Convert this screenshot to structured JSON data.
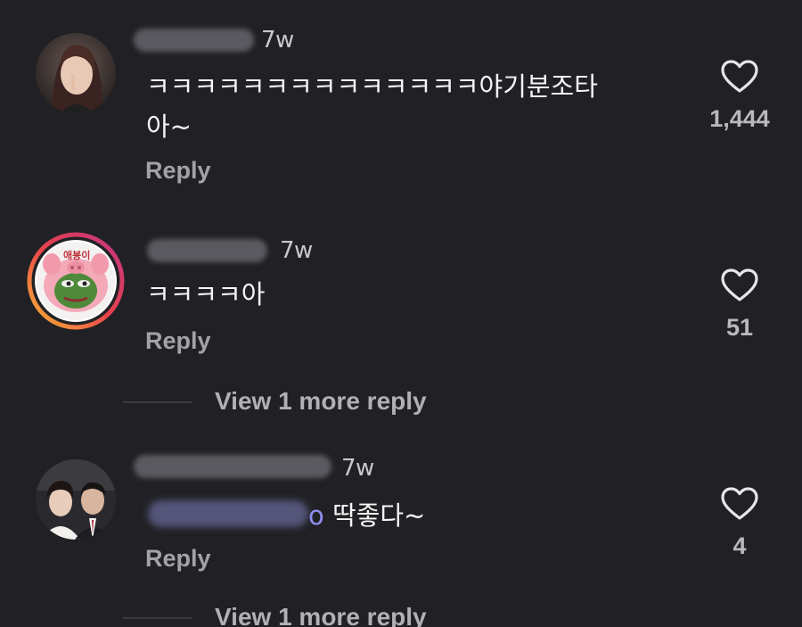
{
  "comments": [
    {
      "time": "7w",
      "text_line1": "ㅋㅋㅋㅋㅋㅋㅋㅋㅋㅋㅋㅋㅋㅋ야기분조타",
      "text_line2": "아~",
      "reply_label": "Reply",
      "likes": "1,444"
    },
    {
      "time": "7w",
      "text_line1": "ㅋㅋㅋㅋ아",
      "reply_label": "Reply",
      "likes": "51",
      "view_more": "View 1 more reply",
      "avatar_sticker_text": "애봉이"
    },
    {
      "time": "7w",
      "mention_tail": "o",
      "text_line1": " 딱좋다~",
      "reply_label": "Reply",
      "likes": "4",
      "view_more": "View 1 more reply"
    }
  ],
  "icons": {
    "like": "heart-outline-icon"
  },
  "colors": {
    "background": "#212125",
    "mention": "#8e8ef0",
    "story_ring_start": "#f7b733",
    "story_ring_end": "#c13584"
  }
}
